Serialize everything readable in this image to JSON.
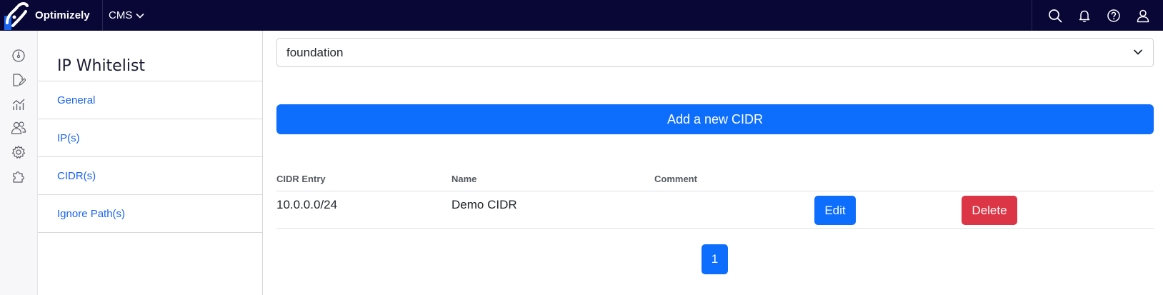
{
  "header": {
    "brand": "Optimizely",
    "product": "CMS",
    "icons": [
      "search-icon",
      "bell-icon",
      "help-icon",
      "user-icon"
    ]
  },
  "rail": {
    "icons": [
      "dashboard-icon",
      "edit-icon",
      "reports-icon",
      "visitor-groups-icon",
      "settings-icon",
      "add-ons-icon"
    ]
  },
  "settings_nav": {
    "title": "IP Whitelist",
    "items": [
      {
        "label": "General"
      },
      {
        "label": "IP(s)"
      },
      {
        "label": "CIDR(s)"
      },
      {
        "label": "Ignore Path(s)"
      }
    ]
  },
  "main": {
    "site_select": {
      "value": "foundation"
    },
    "add_button": "Add a new CIDR",
    "table": {
      "columns": [
        "CIDR Entry",
        "Name",
        "Comment"
      ],
      "rows": [
        {
          "cidr": "10.0.0.0/24",
          "name": "Demo CIDR",
          "comment": "",
          "edit_label": "Edit",
          "delete_label": "Delete"
        }
      ]
    },
    "pagination": {
      "current_page": "1"
    }
  },
  "colors": {
    "topbar": "#080736",
    "primary": "#0d6efd",
    "danger": "#dc3545",
    "link": "#1a64f0"
  }
}
